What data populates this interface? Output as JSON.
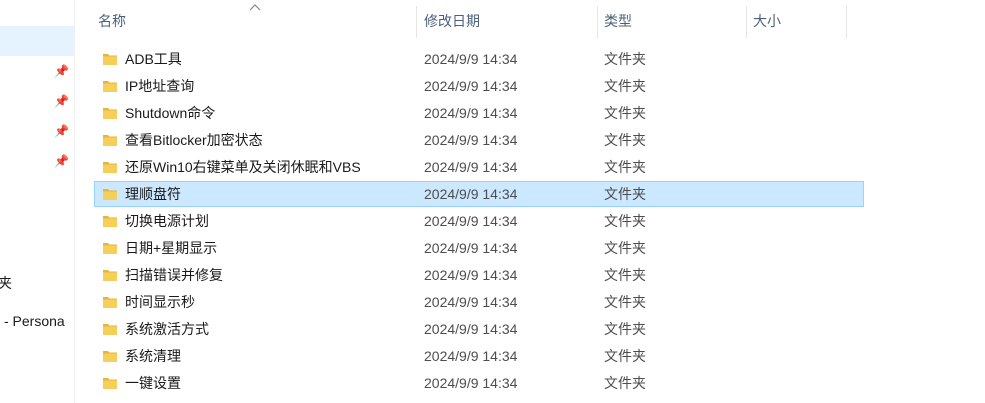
{
  "columns": {
    "name": "名称",
    "modified": "修改日期",
    "type": "类型",
    "size": "大小"
  },
  "nav": {
    "partial_item_1": "夹",
    "partial_item_2": "- Persona"
  },
  "files": [
    {
      "name": "ADB工具",
      "modified": "2024/9/9 14:34",
      "type": "文件夹",
      "selected": false
    },
    {
      "name": "IP地址查询",
      "modified": "2024/9/9 14:34",
      "type": "文件夹",
      "selected": false
    },
    {
      "name": "Shutdown命令",
      "modified": "2024/9/9 14:34",
      "type": "文件夹",
      "selected": false
    },
    {
      "name": "查看Bitlocker加密状态",
      "modified": "2024/9/9 14:34",
      "type": "文件夹",
      "selected": false
    },
    {
      "name": "还原Win10右键菜单及关闭休眠和VBS",
      "modified": "2024/9/9 14:34",
      "type": "文件夹",
      "selected": false
    },
    {
      "name": "理顺盘符",
      "modified": "2024/9/9 14:34",
      "type": "文件夹",
      "selected": true
    },
    {
      "name": "切换电源计划",
      "modified": "2024/9/9 14:34",
      "type": "文件夹",
      "selected": false
    },
    {
      "name": "日期+星期显示",
      "modified": "2024/9/9 14:34",
      "type": "文件夹",
      "selected": false
    },
    {
      "name": "扫描错误并修复",
      "modified": "2024/9/9 14:34",
      "type": "文件夹",
      "selected": false
    },
    {
      "name": "时间显示秒",
      "modified": "2024/9/9 14:34",
      "type": "文件夹",
      "selected": false
    },
    {
      "name": "系统激活方式",
      "modified": "2024/9/9 14:34",
      "type": "文件夹",
      "selected": false
    },
    {
      "name": "系统清理",
      "modified": "2024/9/9 14:34",
      "type": "文件夹",
      "selected": false
    },
    {
      "name": "一键设置",
      "modified": "2024/9/9 14:34",
      "type": "文件夹",
      "selected": false
    }
  ],
  "colors": {
    "header_text": "#4c607a",
    "selected_bg": "#cce8ff",
    "selected_border": "#99d1ff",
    "folder": "#f3c341"
  }
}
